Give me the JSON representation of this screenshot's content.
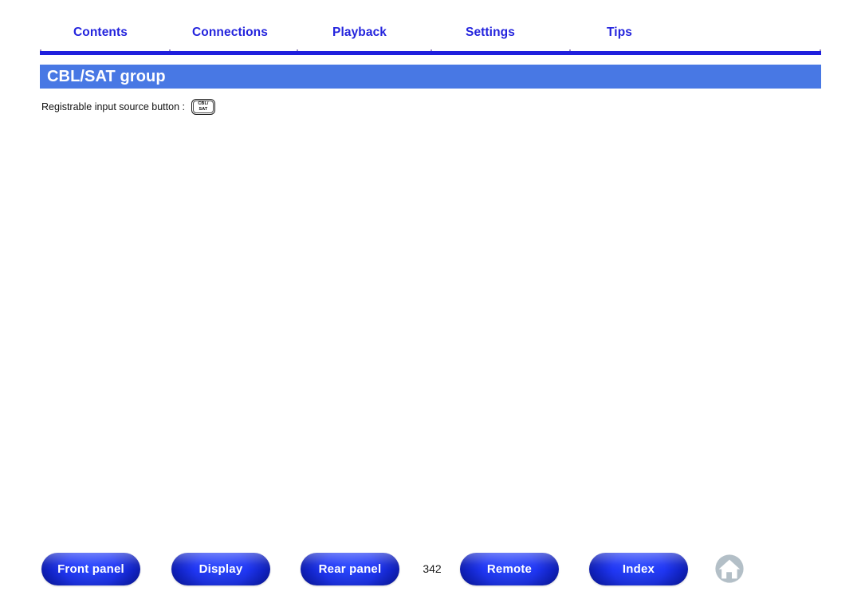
{
  "topnav": {
    "items": [
      {
        "label": "Contents"
      },
      {
        "label": "Connections"
      },
      {
        "label": "Playback"
      },
      {
        "label": "Settings"
      },
      {
        "label": "Tips"
      }
    ]
  },
  "header": {
    "title": "CBL/SAT group",
    "banner_color": "#4878e4"
  },
  "content": {
    "source_label": "Registrable input source button :",
    "key_button": {
      "line1": "CBL/",
      "line2": "SAT"
    }
  },
  "footer": {
    "buttons": [
      {
        "label": "Front panel"
      },
      {
        "label": "Display"
      },
      {
        "label": "Rear panel"
      },
      {
        "label": "Remote"
      },
      {
        "label": "Index"
      }
    ],
    "page_number": "342",
    "home_icon": "home-icon",
    "home_icon_color": "#b3bfc7"
  },
  "colors": {
    "nav_link": "#2424dd",
    "nav_rule": "#1f1fdd",
    "pill_blue": "#1f36f4",
    "text": "#111111"
  }
}
